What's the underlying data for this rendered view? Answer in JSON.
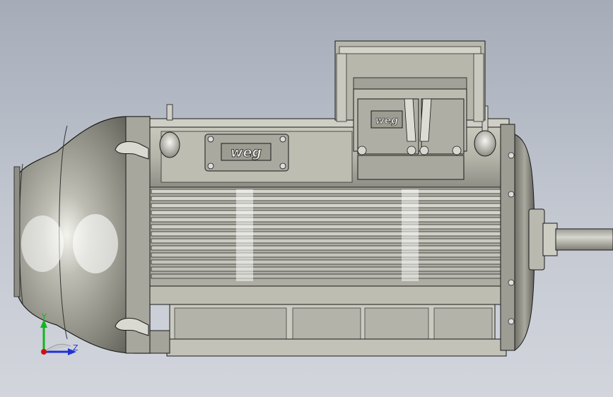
{
  "model": {
    "frame_logo": "weg",
    "terminal_box_logo": "weg"
  },
  "triad": {
    "y_label": "Y",
    "z_label": "Z",
    "y_color": "#13b51d",
    "z_color": "#2030d8",
    "origin_color": "#d01010"
  },
  "colors": {
    "background_top": "#a5acb8",
    "background_bottom": "#d2d5dc",
    "body_metal": "#b9b9ad",
    "outline": "#1a1a1a"
  }
}
